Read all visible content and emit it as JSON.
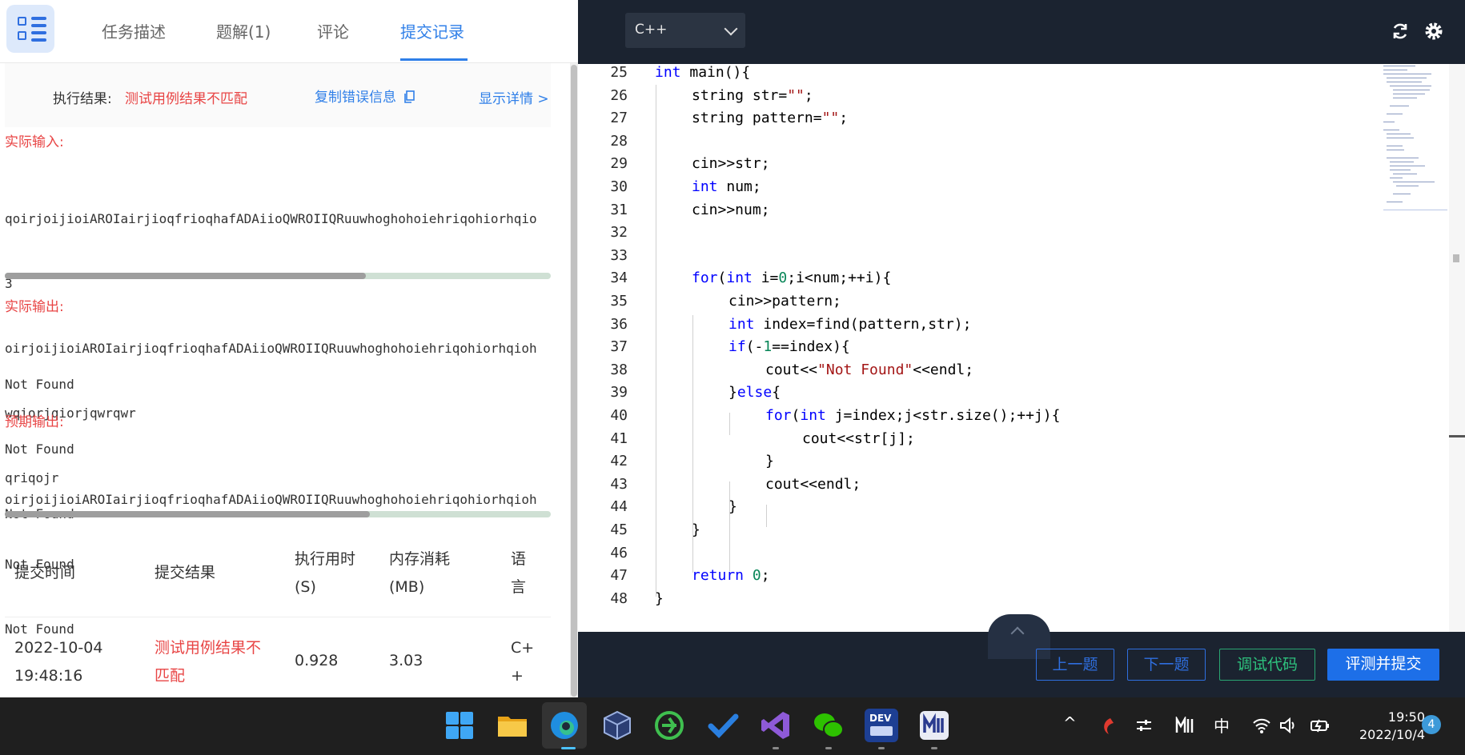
{
  "left_panel": {
    "tabs": [
      {
        "label": "任务描述"
      },
      {
        "label": "题解(1)"
      },
      {
        "label": "评论"
      },
      {
        "label": "提交记录"
      }
    ],
    "result": {
      "label": "执行结果:",
      "value": "测试用例结果不匹配",
      "copy_label": "复制错误信息",
      "detail_label": "显示详情 >"
    },
    "actual_input": {
      "title": "实际输入:",
      "lines": [
        "qoirjoijioiAROIairjioqfrioqhafADAiioQWROIIQRuuwhoghohoiehriqohiorhqio",
        "3",
        "oirjoijioiAROIairjioqfrioqhafADAiioQWROIIQRuuwhoghohoiehriqohiorhqioh",
        "wqiorjqiorjqwrqwr",
        "qriqojr"
      ]
    },
    "actual_output": {
      "title": "实际输出:",
      "lines": [
        "Not Found",
        "Not Found",
        "Not Found"
      ]
    },
    "expected_output": {
      "title": "预期输出:",
      "lines": [
        "oirjoijioiAROIairjioqfrioqhafADAiioQWROIIQRuuwhoghohoiehriqohiorhqioh",
        "Not Found",
        "Not Found"
      ]
    },
    "table": {
      "headers": {
        "time": "提交时间",
        "result": "提交结果",
        "exec_1": "执行用时",
        "exec_2": "(S)",
        "mem_1": "内存消耗",
        "mem_2": "(MB)",
        "lang_1": "语",
        "lang_2": "言"
      },
      "row": {
        "date": "2022-10-04",
        "clock": "19:48:16",
        "result_1": "测试用例结果不",
        "result_2": "匹配",
        "exec": "0.928",
        "mem": "3.03",
        "lang_1": "C+",
        "lang_2": "+"
      }
    }
  },
  "editor": {
    "language": "C++",
    "line_numbers": [
      "25",
      "26",
      "27",
      "28",
      "29",
      "30",
      "31",
      "32",
      "33",
      "34",
      "35",
      "36",
      "37",
      "38",
      "39",
      "40",
      "41",
      "42",
      "43",
      "44",
      "45",
      "46",
      "47",
      "48"
    ],
    "code": {
      "l25_a": "int",
      "l25_b": " main(){",
      "l26_a": "string str=",
      "l26_b": "\"\"",
      "l26_c": ";",
      "l27_a": "string pattern=",
      "l27_b": "\"\"",
      "l27_c": ";",
      "l29": "cin>>str;",
      "l30_a": "int",
      "l30_b": " num;",
      "l31": "cin>>num;",
      "l34_a": "for",
      "l34_b": "(",
      "l34_c": "int",
      "l34_d": " i=",
      "l34_e": "0",
      "l34_f": ";i<num;++i){",
      "l35": "cin>>pattern;",
      "l36_a": "int",
      "l36_b": " index=find(pattern,str);",
      "l37_a": "if",
      "l37_b": "(-",
      "l37_c": "1",
      "l37_d": "==index){",
      "l38_a": "cout<<",
      "l38_b": "\"Not Found\"",
      "l38_c": "<<endl;",
      "l39_a": "}",
      "l39_b": "else",
      "l39_c": "{",
      "l40_a": "for",
      "l40_b": "(",
      "l40_c": "int",
      "l40_d": " j=index;j<str.size();++j){",
      "l41": "cout<<str[j];",
      "l42": "}",
      "l43": "cout<<endl;",
      "l44": "}",
      "l45": "}",
      "l47_a": "return",
      "l47_b": " ",
      "l47_c": "0",
      "l47_d": ";",
      "l48": "}"
    }
  },
  "footer": {
    "prev_label": "上一题",
    "next_label": "下一题",
    "debug_label": "调试代码",
    "submit_label": "评测并提交"
  },
  "taskbar": {
    "ime": "中",
    "time": "19:50",
    "date": "2022/10/4",
    "notifications": "4",
    "dev_badge": "DEV"
  }
}
